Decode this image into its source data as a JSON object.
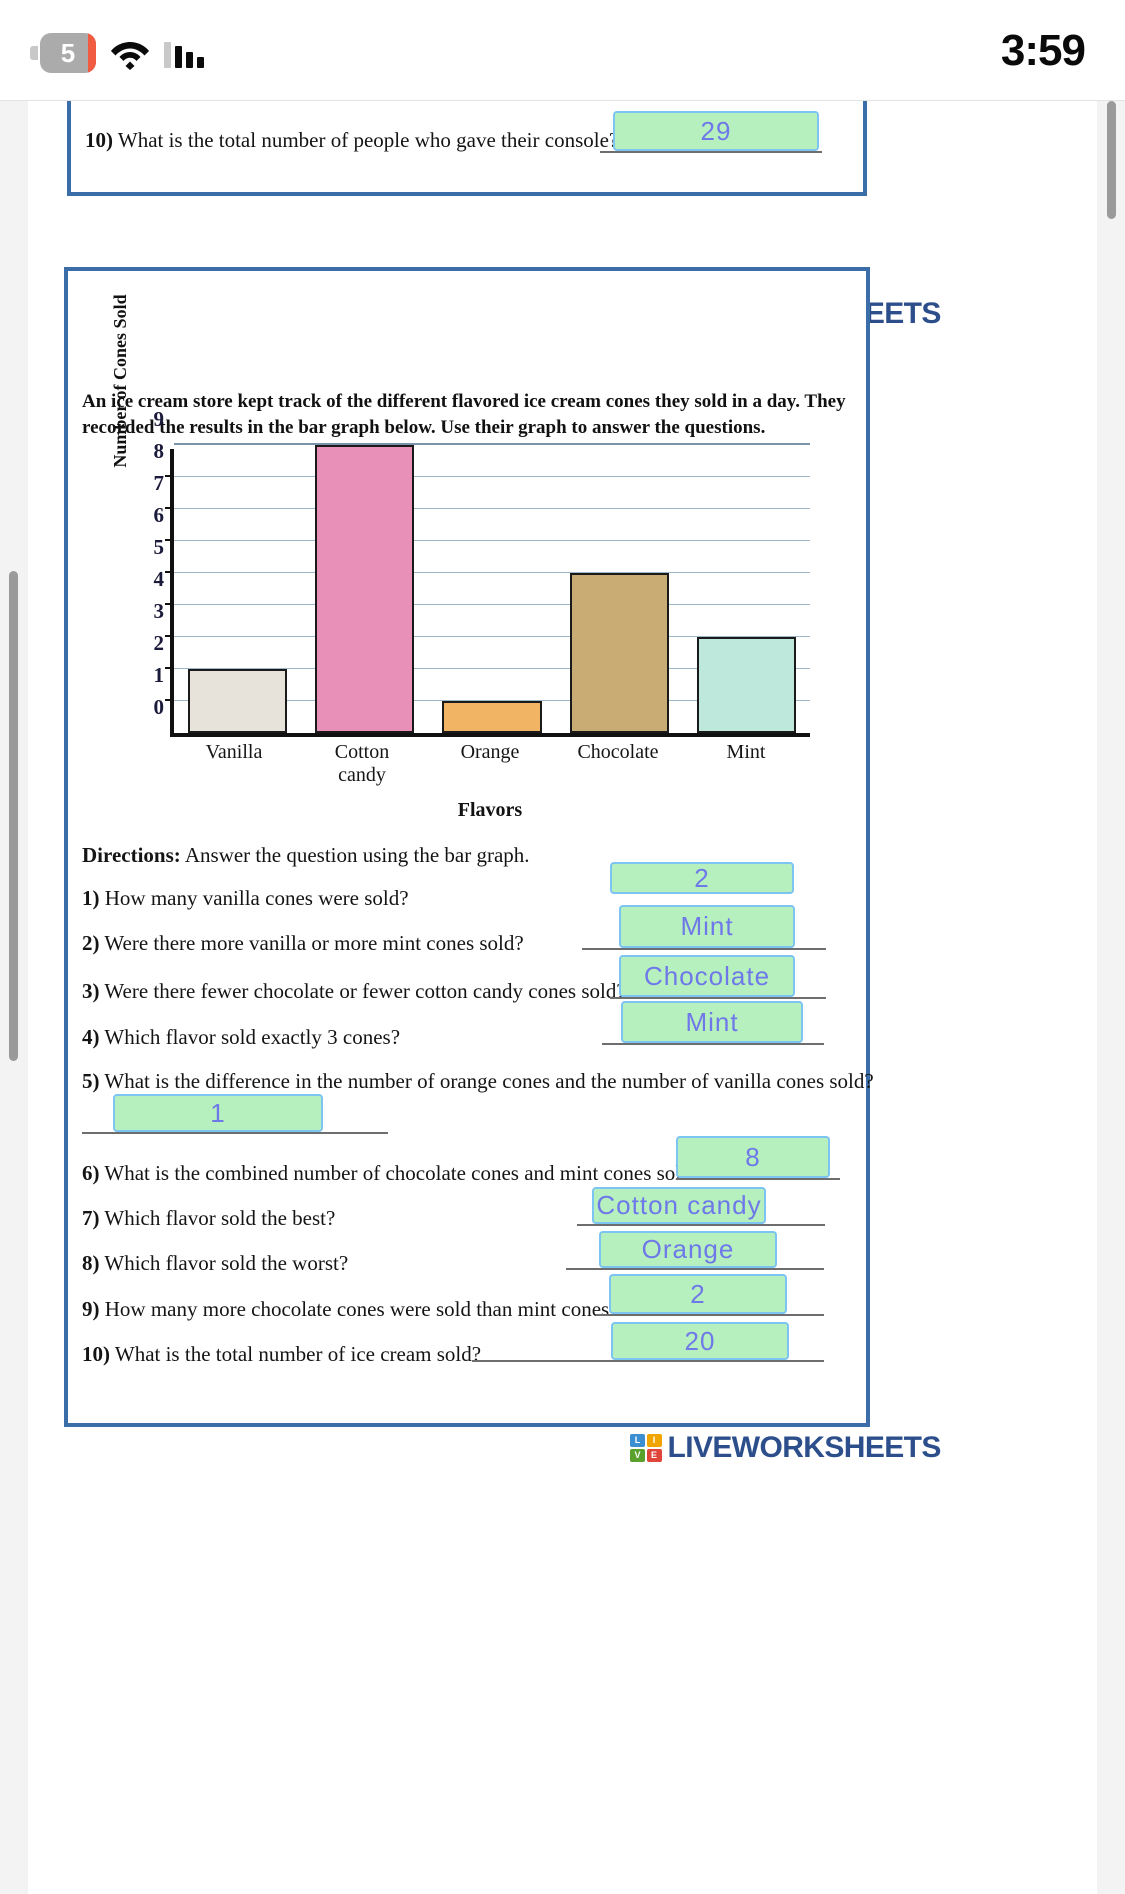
{
  "status_bar": {
    "battery_level": "5",
    "time": "3:59",
    "icons": [
      "battery-icon",
      "wifi-icon",
      "signal-bars-icon"
    ]
  },
  "top_worksheet": {
    "question": "10) What is the total number of people who gave their console?",
    "question_number": "10)",
    "question_text": "What is the total number of people who gave their console?",
    "answer": "29"
  },
  "brand": {
    "logo_letters": [
      "L",
      "I",
      "V",
      "E"
    ],
    "logo_text": "LIVEWORKSHEETS",
    "colors": {
      "text": "#2c4f8c",
      "l": "#3b8ed0",
      "i": "#f0a500",
      "v": "#5aa02c",
      "e": "#e0453a"
    }
  },
  "worksheet": {
    "intro": "An ice cream store kept track of the different flavored ice cream cones they sold in a day. They recorded the results in the bar graph below. Use their graph to answer the questions.",
    "directions_label": "Directions:",
    "directions_text": "Answer the question using the bar graph.",
    "questions": [
      {
        "number": "1)",
        "text": "How many vanilla cones were sold?",
        "answer": "2"
      },
      {
        "number": "2)",
        "text": "Were there more vanilla or more mint cones sold?",
        "answer": "Mint"
      },
      {
        "number": "3)",
        "text": "Were there fewer chocolate or fewer cotton candy cones sold?",
        "answer": "Chocolate"
      },
      {
        "number": "4)",
        "text": "Which flavor sold exactly 3 cones?",
        "answer": "Mint"
      },
      {
        "number": "5)",
        "text": "What is the difference in the number of orange cones and the number of vanilla cones sold?",
        "answer": "1"
      },
      {
        "number": "6)",
        "text": "What is the combined number of chocolate cones and mint cones sold?",
        "answer": "8"
      },
      {
        "number": "7)",
        "text": "Which flavor sold the best?",
        "answer": "Cotton candy"
      },
      {
        "number": "8)",
        "text": "Which flavor sold the worst?",
        "answer": "Orange"
      },
      {
        "number": "9)",
        "text": "How many more chocolate cones were sold than mint cones?",
        "answer": "2"
      },
      {
        "number": "10)",
        "text": "What is the total number of ice cream sold?",
        "answer": "20"
      }
    ]
  },
  "chart_data": {
    "type": "bar",
    "title": "",
    "categories": [
      "Vanilla",
      "Cotton candy",
      "Orange",
      "Chocolate",
      "Mint"
    ],
    "values": [
      2,
      9,
      1,
      5,
      3
    ],
    "xlabel": "Flavors",
    "ylabel": "Number of Cones Sold",
    "ylim": [
      0,
      9
    ],
    "yticks": [
      "0",
      "1",
      "2",
      "3",
      "4",
      "5",
      "6",
      "7",
      "8",
      "9"
    ],
    "grid": true,
    "legend": "none",
    "bar_colors": [
      "#e7e3da",
      "#e890b8",
      "#f0b464",
      "#c9ab74",
      "#bfe8dc"
    ]
  }
}
